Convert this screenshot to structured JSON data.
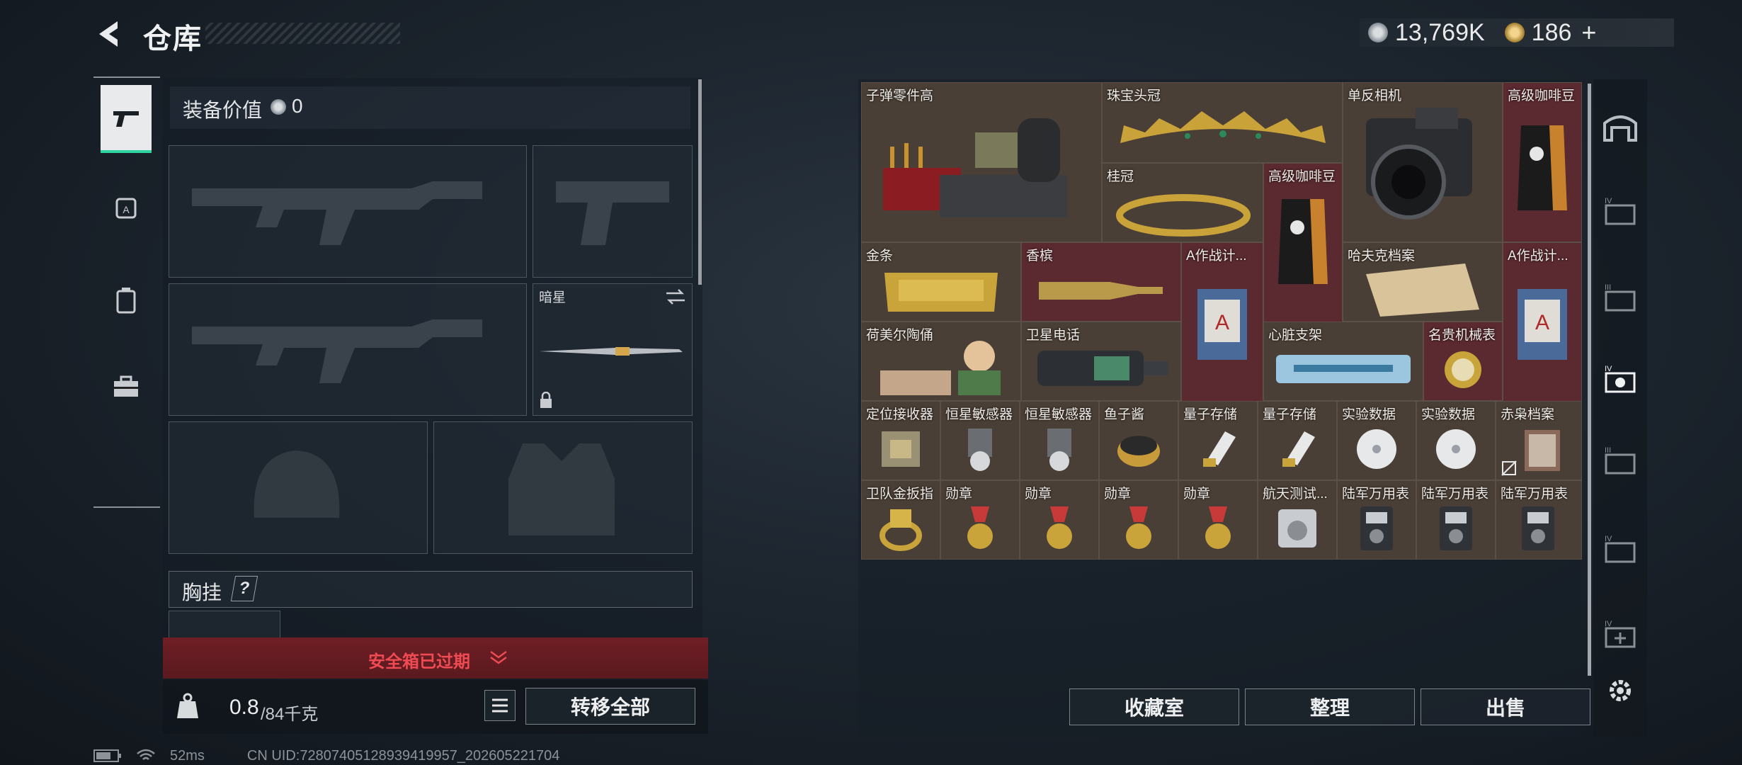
{
  "header": {
    "title": "仓库"
  },
  "currency": {
    "coins": "13,769K",
    "tokens": "186"
  },
  "equipment": {
    "value_label": "装备价值",
    "value": "0",
    "melee_name": "暗星",
    "chest_rig_label": "胸挂",
    "chest_rig_help": "?",
    "safebox_expired": "安全箱已过期",
    "weight_current": "0.8",
    "weight_max": "/84千克",
    "transfer_all": "转移全部"
  },
  "stash": {
    "items": [
      {
        "name": "子弹零件高"
      },
      {
        "name": "珠宝头冠"
      },
      {
        "name": "单反相机"
      },
      {
        "name": "高级咖啡豆"
      },
      {
        "name": "桂冠"
      },
      {
        "name": "高级咖啡豆"
      },
      {
        "name": "金条"
      },
      {
        "name": "香槟"
      },
      {
        "name": "A作战计..."
      },
      {
        "name": "哈夫克档案"
      },
      {
        "name": "A作战计..."
      },
      {
        "name": "荷美尔陶俑"
      },
      {
        "name": "卫星电话"
      },
      {
        "name": "心脏支架"
      },
      {
        "name": "名贵机械表"
      },
      {
        "name": "定位接收器"
      },
      {
        "name": "恒星敏感器"
      },
      {
        "name": "恒星敏感器"
      },
      {
        "name": "鱼子酱"
      },
      {
        "name": "量子存储"
      },
      {
        "name": "量子存储"
      },
      {
        "name": "实验数据"
      },
      {
        "name": "实验数据"
      },
      {
        "name": "赤枭档案"
      },
      {
        "name": "卫队金扳指"
      },
      {
        "name": "勋章"
      },
      {
        "name": "勋章"
      },
      {
        "name": "勋章"
      },
      {
        "name": "勋章"
      },
      {
        "name": "航天测试..."
      },
      {
        "name": "陆军万用表"
      },
      {
        "name": "陆军万用表"
      },
      {
        "name": "陆军万用表"
      }
    ],
    "buttons": {
      "collection": "收藏室",
      "organize": "整理",
      "sell": "出售"
    }
  },
  "status_bar": {
    "ping": "52ms",
    "uid": "CN UID:7280740512893941995​7_202605221704"
  },
  "colors": {
    "accent": "#2fd3a0",
    "danger": "#e0343d",
    "item_bg": "#4a3f36",
    "item_red_bg": "#5a2a30"
  }
}
